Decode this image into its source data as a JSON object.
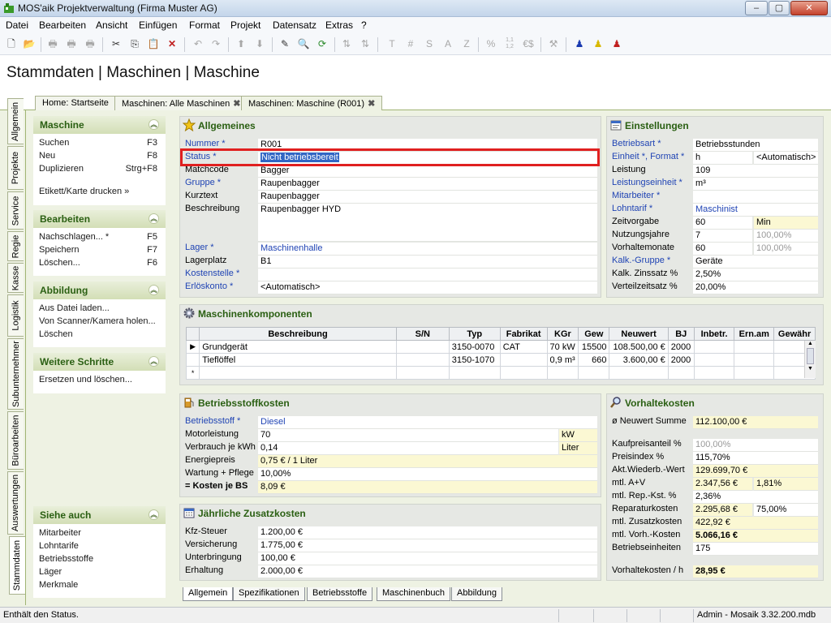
{
  "window": {
    "title": "MOS'aik Projektverwaltung (Firma Muster AG)",
    "min": "–",
    "max": "▢",
    "close": "✕"
  },
  "menu": [
    "Datei",
    "Bearbeiten",
    "Ansicht",
    "Einfügen",
    "Format",
    "Projekt",
    "Datensatz",
    "Extras",
    "?"
  ],
  "toolbar": {
    "text_icons": [
      "T",
      "#",
      "S",
      "A",
      "Z",
      "%",
      "1,1\n1,2",
      "€$"
    ]
  },
  "page_title": "Stammdaten | Maschinen | Maschine",
  "doc_tabs": [
    {
      "label": "Home: Startseite",
      "closable": false
    },
    {
      "label": "Maschinen: Alle Maschinen",
      "closable": true,
      "close": "✖"
    },
    {
      "label": "Maschinen: Maschine (R001)",
      "closable": true,
      "close": "✖",
      "active": true
    }
  ],
  "side_tabs": [
    "Allgemein",
    "Projekte",
    "Service",
    "Regie",
    "Kasse",
    "Logistik",
    "Subunternehmer",
    "Büroarbeiten",
    "Auswertungen",
    "Stammdaten"
  ],
  "tasks": {
    "maschine": {
      "title": "Maschine",
      "items": [
        {
          "label": "Suchen",
          "key": "F3"
        },
        {
          "label": "Neu",
          "key": "F8"
        },
        {
          "label": "Duplizieren",
          "key": "Strg+F8"
        },
        {
          "label": "",
          "key": ""
        },
        {
          "label": "Etikett/Karte drucken »",
          "key": ""
        }
      ]
    },
    "bearbeiten": {
      "title": "Bearbeiten",
      "items": [
        {
          "label": "Nachschlagen... *",
          "key": "F5"
        },
        {
          "label": "Speichern",
          "key": "F7"
        },
        {
          "label": "Löschen...",
          "key": "F6"
        }
      ]
    },
    "abbildung": {
      "title": "Abbildung",
      "items": [
        {
          "label": "Aus Datei laden..."
        },
        {
          "label": "Von Scanner/Kamera holen..."
        },
        {
          "label": "Löschen"
        }
      ]
    },
    "weitere": {
      "title": "Weitere Schritte",
      "items": [
        {
          "label": "Ersetzen und löschen..."
        }
      ]
    },
    "siehe": {
      "title": "Siehe auch",
      "items": [
        {
          "label": "Mitarbeiter"
        },
        {
          "label": "Lohntarife"
        },
        {
          "label": "Betriebsstoffe"
        },
        {
          "label": "Läger"
        },
        {
          "label": "Merkmale"
        }
      ]
    }
  },
  "allgemeines": {
    "title": "Allgemeines",
    "nummer": {
      "label": "Nummer *",
      "value": "R001"
    },
    "status": {
      "label": "Status *",
      "value": "Nicht betriebsbereit"
    },
    "matchcode": {
      "label": "Matchcode",
      "value": "Bagger"
    },
    "gruppe": {
      "label": "Gruppe *",
      "value": "Raupenbagger"
    },
    "kurztext": {
      "label": "Kurztext",
      "value": "Raupenbagger"
    },
    "beschreibung": {
      "label": "Beschreibung",
      "value": "Raupenbagger HYD"
    },
    "lager": {
      "label": "Lager *",
      "value": "Maschinenhalle"
    },
    "lagerplatz": {
      "label": "Lagerplatz",
      "value": "B1"
    },
    "kostenstelle": {
      "label": "Kostenstelle *",
      "value": ""
    },
    "erloeskonto": {
      "label": "Erlöskonto *",
      "value": "<Automatisch>"
    }
  },
  "einstellungen": {
    "title": "Einstellungen",
    "betriebsart": {
      "label": "Betriebsart *",
      "value": "Betriebsstunden"
    },
    "einheit": {
      "label": "Einheit *, Format *",
      "value": "h",
      "value2": "<Automatisch>"
    },
    "leistung": {
      "label": "Leistung",
      "value": "109"
    },
    "leistungseinheit": {
      "label": "Leistungseinheit *",
      "value": "m³"
    },
    "mitarbeiter": {
      "label": "Mitarbeiter *",
      "value": ""
    },
    "lohntarif": {
      "label": "Lohntarif *",
      "value": "Maschinist"
    },
    "zeitvorgabe": {
      "label": "Zeitvorgabe",
      "value": "60",
      "value2": "Min"
    },
    "nutzungsjahre": {
      "label": "Nutzungsjahre",
      "value": "7",
      "value2": "100,00%"
    },
    "vorhaltemonate": {
      "label": "Vorhaltemonate",
      "value": "60",
      "value2": "100,00%"
    },
    "kalkgruppe": {
      "label": "Kalk.-Gruppe *",
      "value": "Geräte"
    },
    "zinssatz": {
      "label": "Kalk. Zinssatz %",
      "value": "2,50%"
    },
    "verteilzeitsatz": {
      "label": "Verteilzeitsatz %",
      "value": "20,00%"
    }
  },
  "komponenten": {
    "title": "Maschinenkomponenten",
    "columns": [
      "Beschreibung",
      "S/N",
      "Typ",
      "Fabrikat",
      "KGr",
      "Gew",
      "Neuwert",
      "BJ",
      "Inbetr.",
      "Ern.am",
      "Gewähr"
    ],
    "rows": [
      {
        "marker": "▶",
        "cells": [
          "Grundgerät",
          "",
          "3150-0070",
          "CAT",
          "70 kW",
          "15500",
          "108.500,00 €",
          "2000",
          "",
          "",
          ""
        ]
      },
      {
        "marker": "",
        "cells": [
          "Tieflöffel",
          "",
          "3150-1070",
          "",
          "0,9 m³",
          "660",
          "3.600,00 €",
          "2000",
          "",
          "",
          ""
        ]
      },
      {
        "marker": "*",
        "cells": [
          "",
          "",
          "",
          "",
          "",
          "",
          "",
          "",
          "",
          "",
          ""
        ]
      }
    ]
  },
  "betriebsstoffkosten": {
    "title": "Betriebsstoffkosten",
    "betriebsstoff": {
      "label": "Betriebsstoff *",
      "value": "Diesel"
    },
    "motorleistung": {
      "label": "Motorleistung",
      "value": "70",
      "unit": "kW"
    },
    "verbrauch": {
      "label": "Verbrauch je kWh",
      "value": "0,14",
      "unit": "Liter"
    },
    "energiepreis": {
      "label": "Energiepreis",
      "value": "0,75 € / 1 Liter"
    },
    "wartung": {
      "label": "Wartung + Pflege",
      "value": "10,00%"
    },
    "kosten": {
      "label": "= Kosten je BS",
      "value": "8,09 €"
    }
  },
  "zusatzkosten": {
    "title": "Jährliche Zusatzkosten",
    "kfz": {
      "label": "Kfz-Steuer",
      "value": "1.200,00 €"
    },
    "versicherung": {
      "label": "Versicherung",
      "value": "1.775,00 €"
    },
    "unterbringung": {
      "label": "Unterbringung",
      "value": "100,00 €"
    },
    "erhaltung": {
      "label": "Erhaltung",
      "value": "2.000,00 €"
    }
  },
  "vorhaltekosten": {
    "title": "Vorhaltekosten",
    "neuwert": {
      "label": "ø Neuwert Summe",
      "value": "112.100,00 €"
    },
    "kaufpreis": {
      "label": "Kaufpreisanteil %",
      "value": "100,00%"
    },
    "preisindex": {
      "label": "Preisindex %",
      "value": "115,70%"
    },
    "wiederb": {
      "label": "Akt.Wiederb.-Wert",
      "value": "129.699,70 €"
    },
    "av": {
      "label": "mtl. A+V",
      "value": "2.347,56 €",
      "value2": "1,81%"
    },
    "rep": {
      "label": "mtl. Rep.-Kst. %",
      "value": "2,36%"
    },
    "reparatur": {
      "label": "Reparaturkosten",
      "value": "2.295,68 €",
      "value2": "75,00%"
    },
    "zusatz": {
      "label": "mtl. Zusatzkosten",
      "value": "422,92 €"
    },
    "vorh": {
      "label": "mtl. Vorh.-Kosten",
      "value": "5.066,16 €"
    },
    "einheiten": {
      "label": "Betriebseinheiten",
      "value": "175"
    },
    "proh": {
      "label": "Vorhaltekosten / h",
      "value": "28,95 €"
    }
  },
  "bottom_tabs": [
    "Allgemein",
    "Spezifikationen",
    "Betriebsstoffe",
    "Maschinenbuch",
    "Abbildung"
  ],
  "statusbar": {
    "message": "Enthält den Status.",
    "user": "Admin - Mosaik 3.32.200.mdb"
  }
}
